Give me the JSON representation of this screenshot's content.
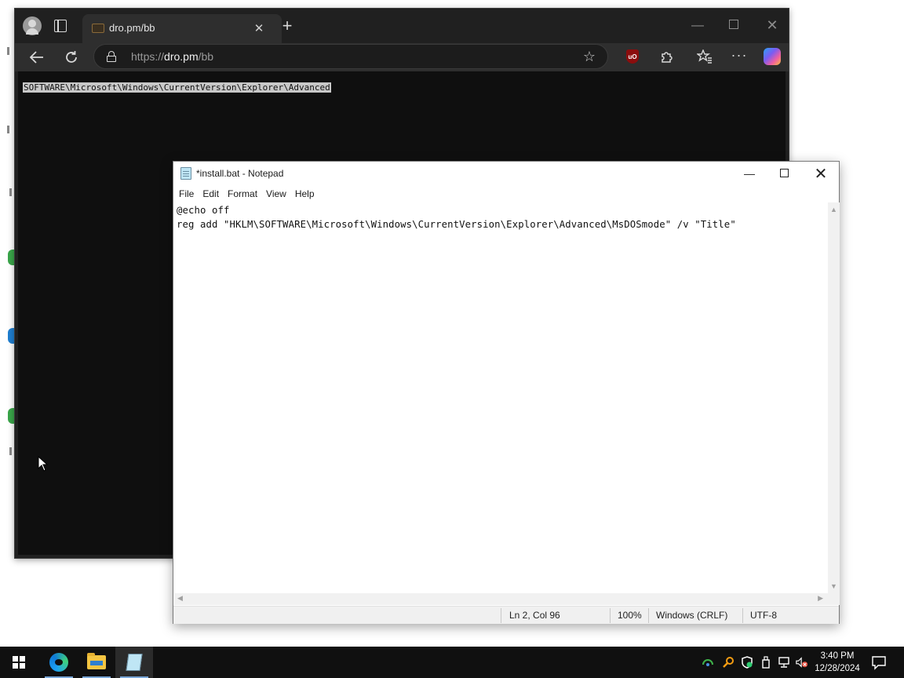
{
  "browser": {
    "tab_title": "dro.pm/bb",
    "url": {
      "scheme": "https://",
      "host": "dro.pm",
      "path": "/bb"
    },
    "page_text": "SOFTWARE\\Microsoft\\Windows\\CurrentVersion\\Explorer\\Advanced",
    "extension_badge": "uO",
    "icons": {
      "back": "back-arrow-icon",
      "refresh": "refresh-icon",
      "lock": "lock-icon",
      "favorite": "star-icon",
      "extensions": "puzzle-icon",
      "favorites": "favorites-icon",
      "more": "more-icon",
      "copilot": "copilot-icon"
    }
  },
  "notepad": {
    "title": "*install.bat - Notepad",
    "menu": [
      "File",
      "Edit",
      "Format",
      "View",
      "Help"
    ],
    "content_lines": [
      "@echo off",
      "reg add \"HKLM\\SOFTWARE\\Microsoft\\Windows\\CurrentVersion\\Explorer\\Advanced\\MsDOSmode\" /v \"Title\""
    ],
    "status": {
      "position": "Ln 2, Col 96",
      "zoom": "100%",
      "line_ending": "Windows (CRLF)",
      "encoding": "UTF-8"
    }
  },
  "taskbar": {
    "apps": [
      "start",
      "edge",
      "file-explorer",
      "notepad"
    ],
    "active_app": "notepad",
    "clock": {
      "time": "3:40 PM",
      "date": "12/28/2024"
    }
  },
  "colors": {
    "browser_bg": "#202020",
    "browser_toolbar": "#2e2e2e",
    "taskbar_bg": "#101010",
    "notepad_status_bg": "#f0f0f0"
  }
}
